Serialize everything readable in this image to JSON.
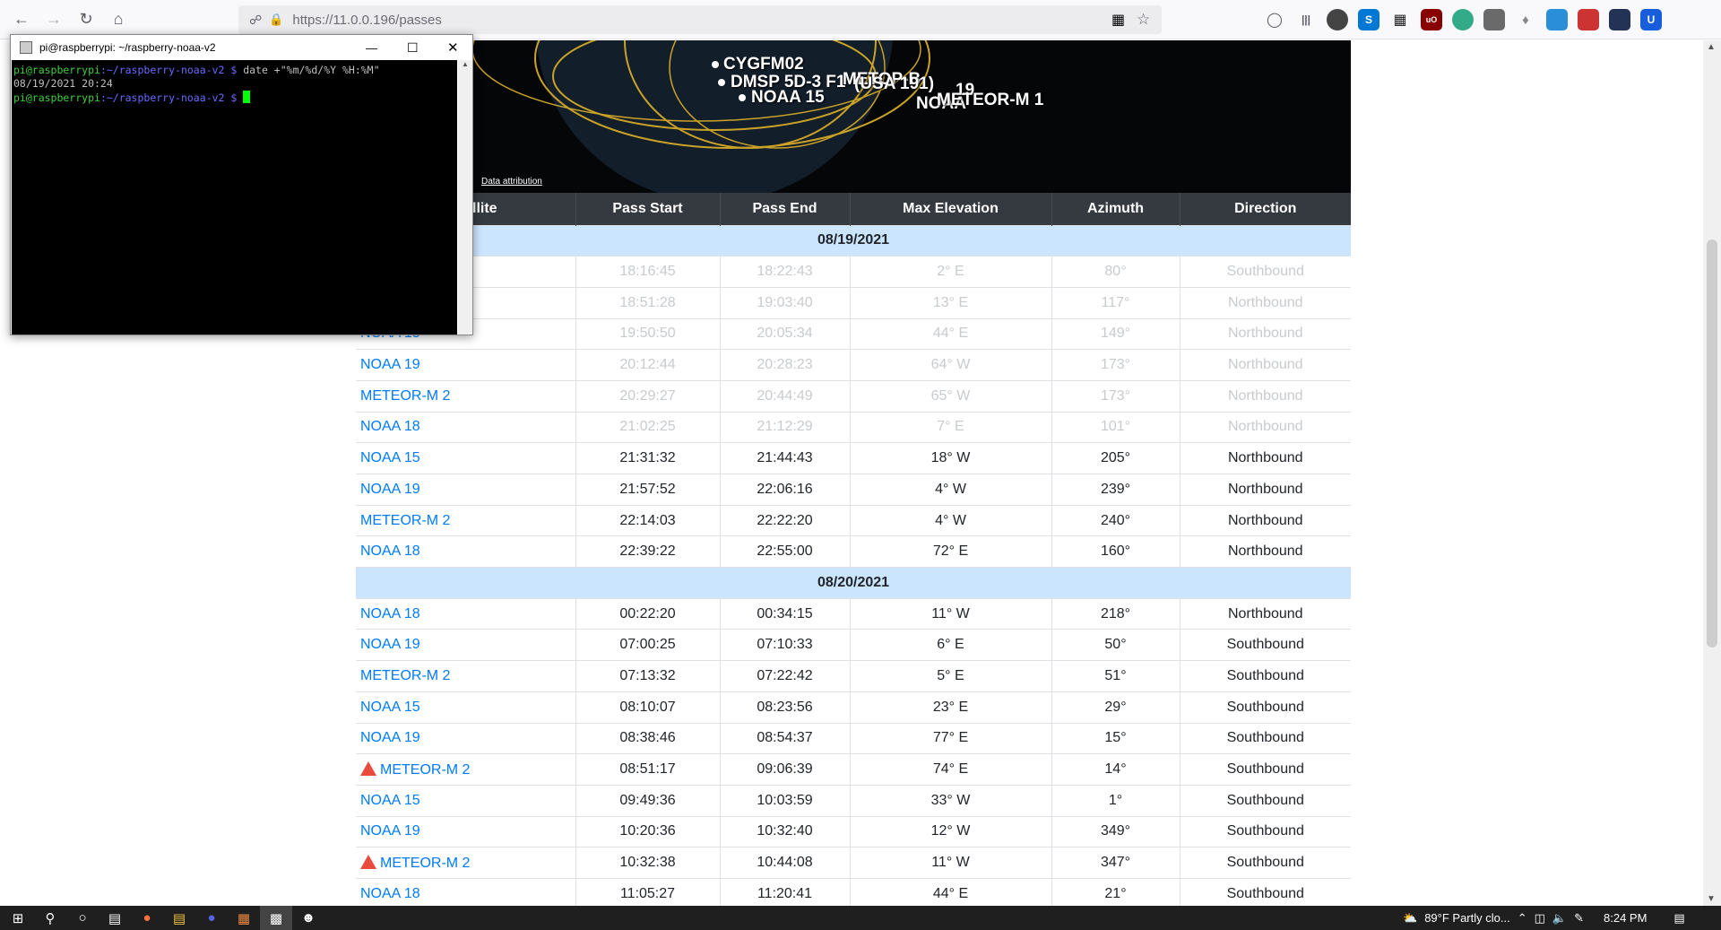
{
  "browser": {
    "url": "https://11.0.0.196/passes",
    "nav": {
      "back": "←",
      "forward": "→",
      "reload": "↻",
      "home": "⌂"
    }
  },
  "globe": {
    "labels": [
      "CYGFM02",
      "DMSP 5D-3 F1",
      "METOP-B",
      "(USA 191)",
      "NOAA 15",
      "19",
      "NOAA",
      "METEOR-M 1"
    ],
    "attribution": "Data attribution"
  },
  "table": {
    "headers": [
      "Satellite",
      "Pass Start",
      "Pass End",
      "Max Elevation",
      "Azimuth",
      "Direction"
    ],
    "header_partial": "llite",
    "groups": [
      {
        "date": "08/19/2021",
        "rows": [
          {
            "sat": "",
            "start": "18:16:45",
            "end": "18:22:43",
            "elev": "2° E",
            "az": "80°",
            "dir": "Southbound",
            "past": true
          },
          {
            "sat": "",
            "start": "18:51:28",
            "end": "19:03:40",
            "elev": "13° E",
            "az": "117°",
            "dir": "Northbound",
            "past": true
          },
          {
            "sat": "NOAA 15",
            "start": "19:50:50",
            "end": "20:05:34",
            "elev": "44° E",
            "az": "149°",
            "dir": "Northbound",
            "past": true
          },
          {
            "sat": "NOAA 19",
            "start": "20:12:44",
            "end": "20:28:23",
            "elev": "64° W",
            "az": "173°",
            "dir": "Northbound",
            "past": true
          },
          {
            "sat": "METEOR-M 2",
            "start": "20:29:27",
            "end": "20:44:49",
            "elev": "65° W",
            "az": "173°",
            "dir": "Northbound",
            "past": true
          },
          {
            "sat": "NOAA 18",
            "start": "21:02:25",
            "end": "21:12:29",
            "elev": "7° E",
            "az": "101°",
            "dir": "Northbound",
            "past": true
          },
          {
            "sat": "NOAA 15",
            "start": "21:31:32",
            "end": "21:44:43",
            "elev": "18° W",
            "az": "205°",
            "dir": "Northbound",
            "past": false
          },
          {
            "sat": "NOAA 19",
            "start": "21:57:52",
            "end": "22:06:16",
            "elev": "4° W",
            "az": "239°",
            "dir": "Northbound",
            "past": false
          },
          {
            "sat": "METEOR-M 2",
            "start": "22:14:03",
            "end": "22:22:20",
            "elev": "4° W",
            "az": "240°",
            "dir": "Northbound",
            "past": false
          },
          {
            "sat": "NOAA 18",
            "start": "22:39:22",
            "end": "22:55:00",
            "elev": "72° E",
            "az": "160°",
            "dir": "Northbound",
            "past": false
          }
        ]
      },
      {
        "date": "08/20/2021",
        "rows": [
          {
            "sat": "NOAA 18",
            "start": "00:22:20",
            "end": "00:34:15",
            "elev": "11° W",
            "az": "218°",
            "dir": "Northbound",
            "past": false
          },
          {
            "sat": "NOAA 19",
            "start": "07:00:25",
            "end": "07:10:33",
            "elev": "6° E",
            "az": "50°",
            "dir": "Southbound",
            "past": false
          },
          {
            "sat": "METEOR-M 2",
            "start": "07:13:32",
            "end": "07:22:42",
            "elev": "5° E",
            "az": "51°",
            "dir": "Southbound",
            "past": false
          },
          {
            "sat": "NOAA 15",
            "start": "08:10:07",
            "end": "08:23:56",
            "elev": "23° E",
            "az": "29°",
            "dir": "Southbound",
            "past": false
          },
          {
            "sat": "NOAA 19",
            "start": "08:38:46",
            "end": "08:54:37",
            "elev": "77° E",
            "az": "15°",
            "dir": "Southbound",
            "past": false
          },
          {
            "sat": "METEOR-M 2",
            "start": "08:51:17",
            "end": "09:06:39",
            "elev": "74° E",
            "az": "14°",
            "dir": "Southbound",
            "past": false,
            "warn": true
          },
          {
            "sat": "NOAA 15",
            "start": "09:49:36",
            "end": "10:03:59",
            "elev": "33° W",
            "az": "1°",
            "dir": "Southbound",
            "past": false
          },
          {
            "sat": "NOAA 19",
            "start": "10:20:36",
            "end": "10:32:40",
            "elev": "12° W",
            "az": "349°",
            "dir": "Southbound",
            "past": false
          },
          {
            "sat": "METEOR-M 2",
            "start": "10:32:38",
            "end": "10:44:08",
            "elev": "11° W",
            "az": "347°",
            "dir": "Southbound",
            "past": false,
            "warn": true
          },
          {
            "sat": "NOAA 18",
            "start": "11:05:27",
            "end": "11:20:41",
            "elev": "44° E",
            "az": "21°",
            "dir": "Southbound",
            "past": false
          }
        ]
      }
    ]
  },
  "terminal": {
    "title": "pi@raspberrypi: ~/raspberry-noaa-v2",
    "min": "—",
    "max": "☐",
    "close": "✕",
    "prompt_user": "pi@raspberrypi",
    "prompt_path": ":~/raspberry-noaa-v2 $",
    "command": " date +\"%m/%d/%Y %H:%M\"",
    "output": "08/19/2021 20:24"
  },
  "taskbar": {
    "weather": "89°F  Partly clo...",
    "time": "8:24 PM"
  },
  "colors": {
    "link": "#007bff",
    "date_row": "#cce5ff",
    "header": "#343a40",
    "warn": "#e74c3c"
  }
}
